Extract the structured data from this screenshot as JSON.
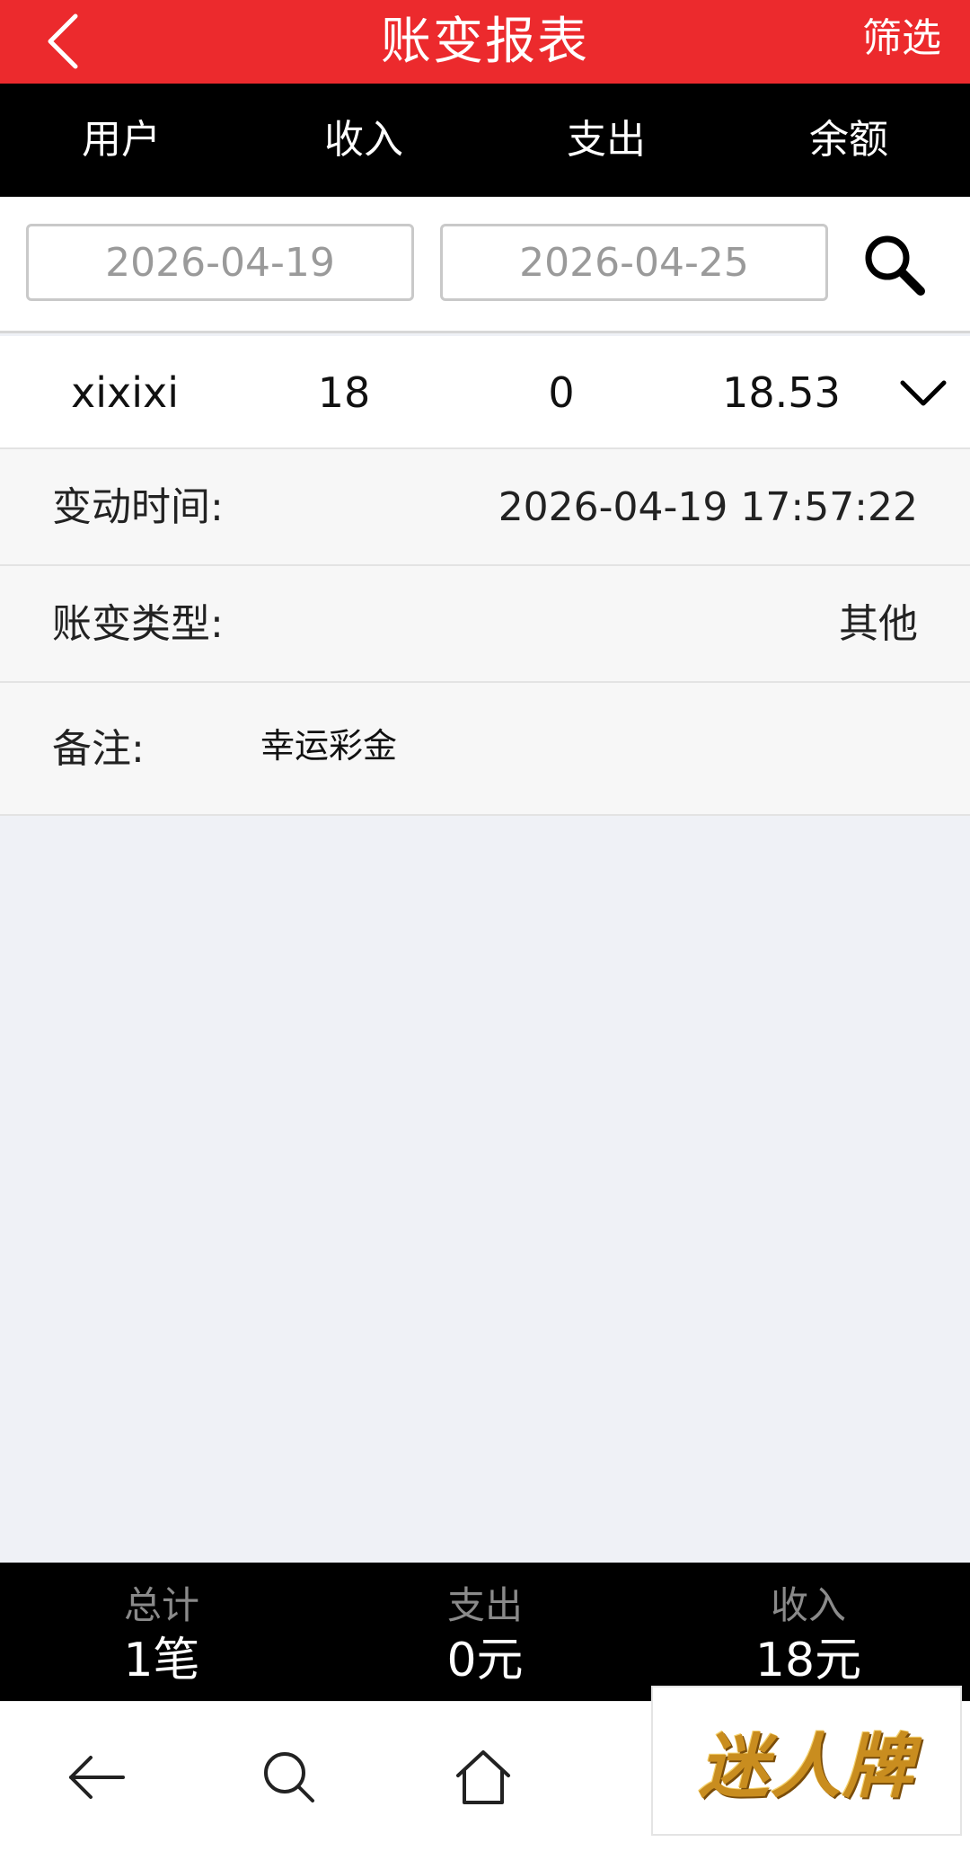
{
  "header": {
    "title": "账变报表",
    "filter_label": "筛选",
    "icons": {
      "back": "chevron-left-icon"
    }
  },
  "columns": [
    "用户",
    "收入",
    "支出",
    "余额"
  ],
  "filters": {
    "start_date_placeholder": "2026-04-19",
    "end_date_placeholder": "2026-04-25",
    "search_icon": "search-icon"
  },
  "record": {
    "user": "xixixi",
    "income": "18",
    "expense": "0",
    "balance": "18.53",
    "expand_icon": "chevron-down-icon",
    "details": {
      "time_label": "变动时间:",
      "time_value": "2026-04-19 17:57:22",
      "type_label": "账变类型:",
      "type_value": "其他",
      "note_label": "备注:",
      "note_value": "幸运彩金"
    }
  },
  "totals": {
    "count_label": "总计",
    "count_value": "1笔",
    "expense_label": "支出",
    "expense_value": "0元",
    "income_label": "收入",
    "income_value": "18元"
  },
  "browser_nav": {
    "icons": [
      "back-arrow-icon",
      "search-icon",
      "home-icon"
    ]
  },
  "promo": {
    "logo_text": "迷人牌"
  },
  "colors": {
    "header_red": "#ec2a2d",
    "bar_black": "#000000",
    "page_bg": "#eff1f6",
    "logo_gold": "#c98d1f"
  }
}
